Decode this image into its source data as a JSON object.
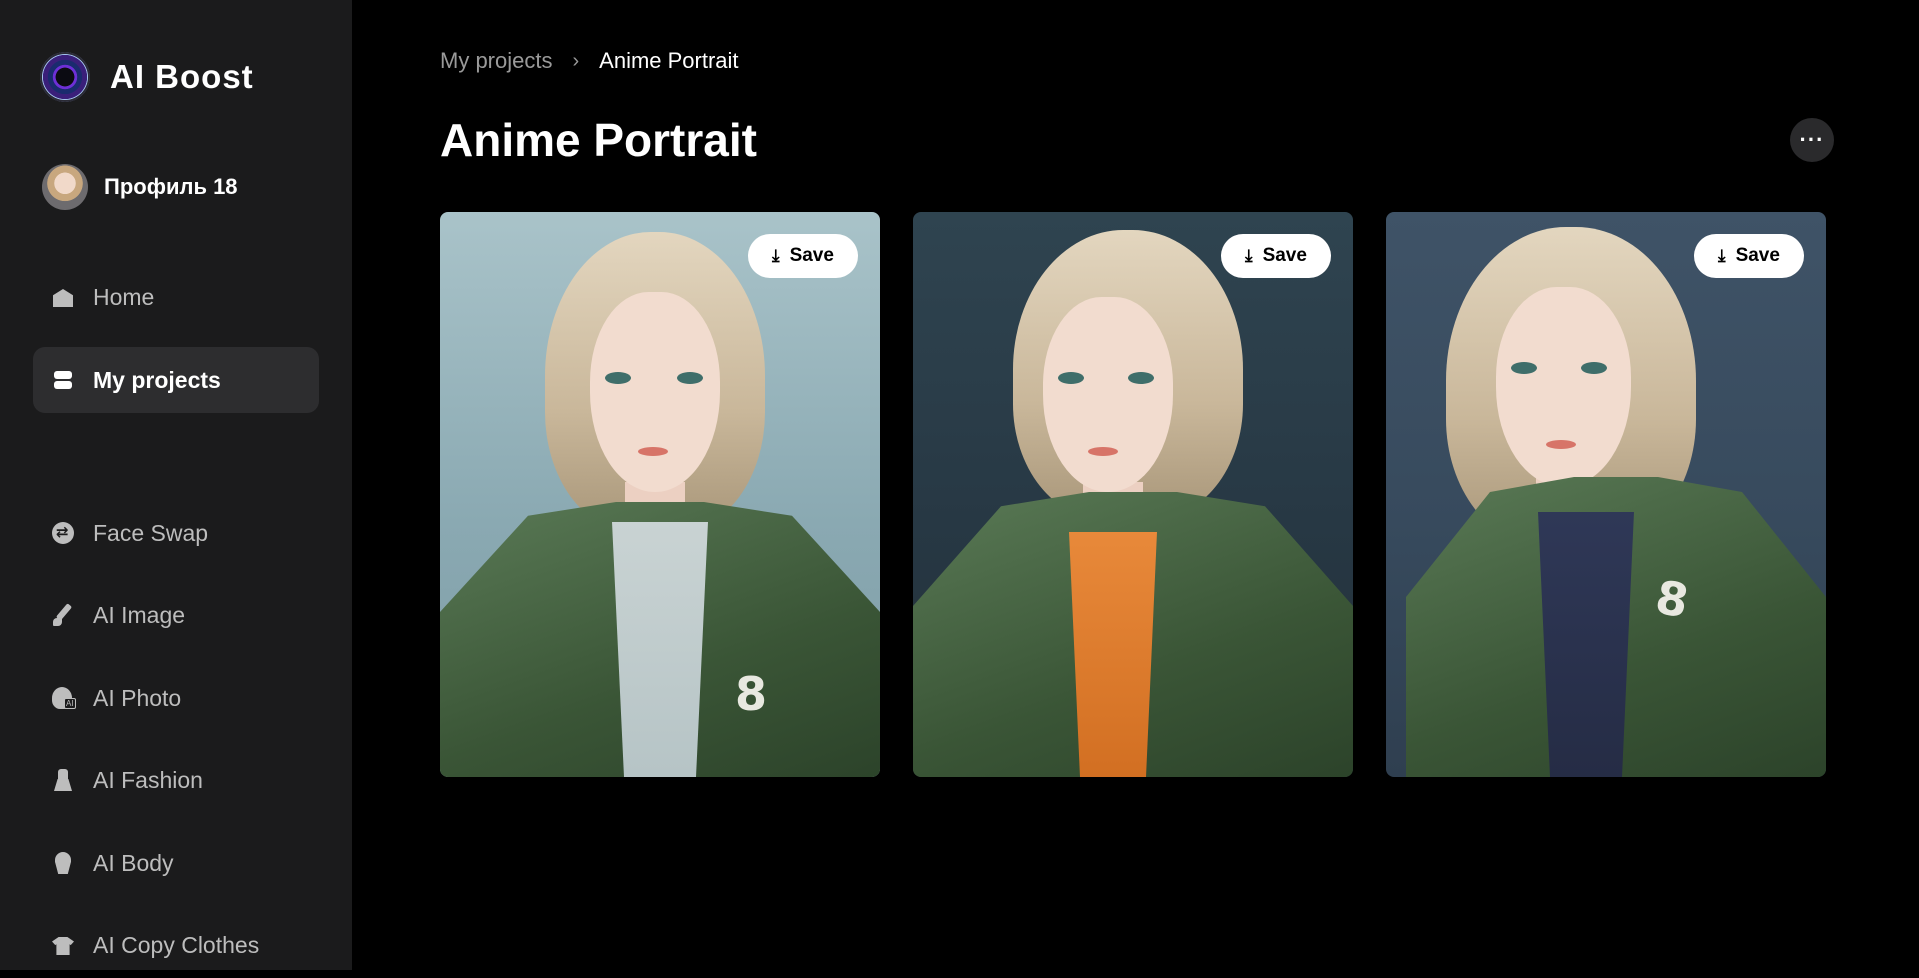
{
  "app": {
    "brand_name": "AI Boost"
  },
  "profile": {
    "name": "Профиль 18"
  },
  "sidebar": {
    "items": [
      {
        "label": "Home",
        "icon": "home-icon"
      },
      {
        "label": "My projects",
        "icon": "projects-icon",
        "active": true
      },
      {
        "label": "Face Swap",
        "icon": "face-swap-icon"
      },
      {
        "label": "AI Image",
        "icon": "brush-icon"
      },
      {
        "label": "AI Photo",
        "icon": "ai-photo-icon"
      },
      {
        "label": "AI Fashion",
        "icon": "dress-icon"
      },
      {
        "label": "AI Body",
        "icon": "body-icon"
      },
      {
        "label": "AI Copy Clothes",
        "icon": "shirt-icon"
      }
    ]
  },
  "breadcrumb": {
    "parent": "My projects",
    "separator": "›",
    "current": "Anime Portrait"
  },
  "page": {
    "title": "Anime Portrait",
    "more_label": "···"
  },
  "gallery": {
    "save_label": "Save",
    "images": [
      {
        "description": "anime portrait 1",
        "background": "#97b4bb",
        "shirt": "#c8d3d3"
      },
      {
        "description": "anime portrait 2",
        "background": "#2b3d48",
        "shirt": "#e07c2e"
      },
      {
        "description": "anime portrait 3",
        "background": "#3b4e62",
        "shirt": "#2d3550"
      }
    ],
    "badge_text": "8"
  },
  "colors": {
    "sidebar_bg": "#1b1b1c",
    "active_item_bg": "#2d2d2f",
    "main_bg": "#000000"
  }
}
